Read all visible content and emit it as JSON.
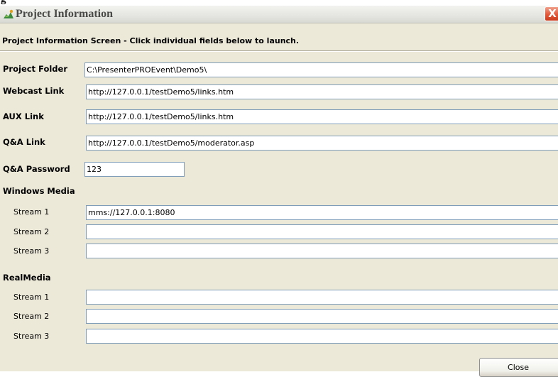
{
  "window": {
    "title": "Project Information",
    "close_glyph": "X",
    "heading": "Project Information Screen - Click individual fields below to launch."
  },
  "fields": {
    "project_folder": {
      "label": "Project Folder",
      "value": "C:\\PresenterPROEvent\\Demo5\\"
    },
    "webcast_link": {
      "label": "Webcast Link",
      "value": "http://127.0.0.1/testDemo5/links.htm"
    },
    "aux_link": {
      "label": "AUX Link",
      "value": "http://127.0.0.1/testDemo5/links.htm"
    },
    "qa_link": {
      "label": "Q&A Link",
      "value": "http://127.0.0.1/testDemo5/moderator.asp"
    },
    "qa_password": {
      "label": "Q&A Password",
      "value": "123"
    }
  },
  "windows_media": {
    "heading": "Windows Media",
    "streams": [
      {
        "label": "Stream 1",
        "value": "mms://127.0.0.1:8080"
      },
      {
        "label": "Stream 2",
        "value": ""
      },
      {
        "label": "Stream 3",
        "value": ""
      }
    ]
  },
  "real_media": {
    "heading": "RealMedia",
    "streams": [
      {
        "label": "Stream 1",
        "value": ""
      },
      {
        "label": "Stream 2",
        "value": ""
      },
      {
        "label": "Stream 3",
        "value": ""
      }
    ]
  },
  "buttons": {
    "close_label": "Close"
  },
  "top_strip": {
    "glyph": "g"
  },
  "icons": {
    "app_icon": "project-app-icon",
    "close_icon": "close-icon"
  },
  "colors": {
    "window_face": "#ece9d8",
    "field_border": "#7f9db9",
    "close_button": "#e2593a"
  }
}
